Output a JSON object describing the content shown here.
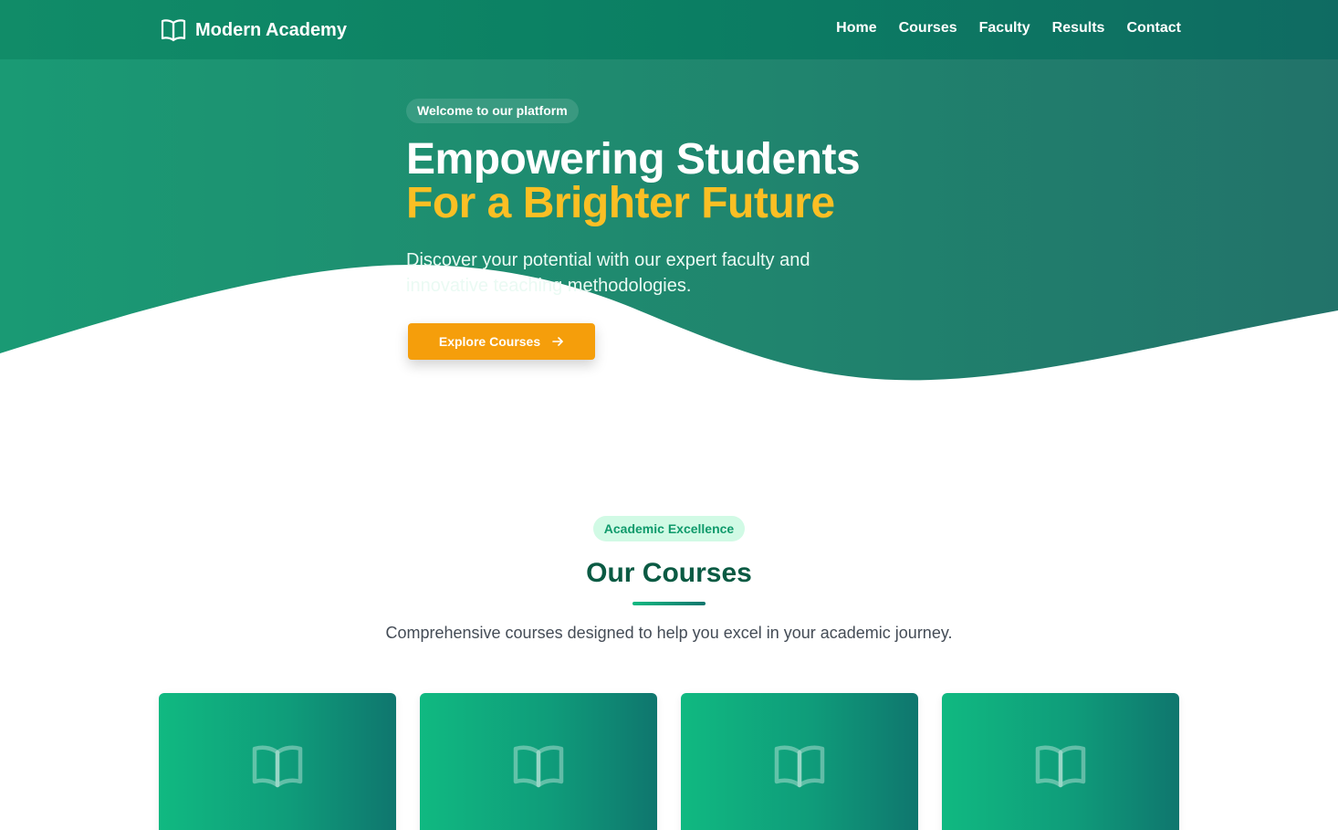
{
  "navbar": {
    "brand": "Modern Academy",
    "brand_icon": "book-open-icon",
    "links": [
      "Home",
      "Courses",
      "Faculty",
      "Results",
      "Contact"
    ]
  },
  "hero": {
    "badge": "Welcome to our platform",
    "title_line1": "Empowering Students",
    "title_line2": "For a Brighter Future",
    "subtitle": "Discover your potential with our expert faculty and innovative teaching methodologies.",
    "cta_label": "Explore Courses",
    "cta_icon": "arrow-right-icon"
  },
  "courses_section": {
    "badge": "Academic Excellence",
    "title": "Our Courses",
    "subtitle": "Comprehensive courses designed to help you excel in your academic journey.",
    "card_icon": "book-open-icon",
    "card_count": 4
  },
  "colors": {
    "primary": "#10b981",
    "primary_dark": "#0f766e",
    "accent": "#f59e0b",
    "accent_text": "#fbbf24",
    "heading": "#0a5a43"
  }
}
